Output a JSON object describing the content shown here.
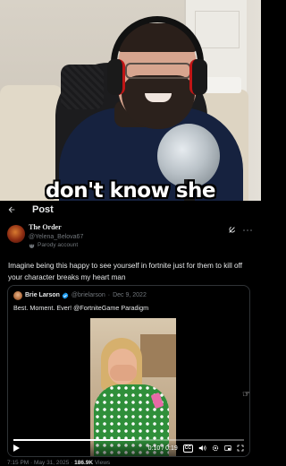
{
  "stream": {
    "caption": "don't know she"
  },
  "header": {
    "title": "Post"
  },
  "tweet": {
    "author_name": "The Order",
    "author_handle": "@Yelena_Belova67",
    "parody_label": "Parody account",
    "text": "Imagine being this happy to see yourself in fortnite just for them to kill off your character breaks my heart man"
  },
  "quote": {
    "author_name": "Brie Larson",
    "author_handle": "@brielarson",
    "separator": "·",
    "date": "Dec 9, 2022",
    "text": "Best. Moment. Ever! @FortniteGame Paradigm",
    "video": {
      "time": "0:10 / 0:19",
      "progress": 0.526,
      "cc_label": "CC"
    }
  },
  "footer": {
    "timestamp": "7:15 PM · May 31, 2025 ·",
    "views_count": "186.9K",
    "views_label": "Views"
  },
  "colors": {
    "accent": "#1d9bf0",
    "muted": "#71767b",
    "border": "#2f3336",
    "text": "#e7e9ea"
  }
}
